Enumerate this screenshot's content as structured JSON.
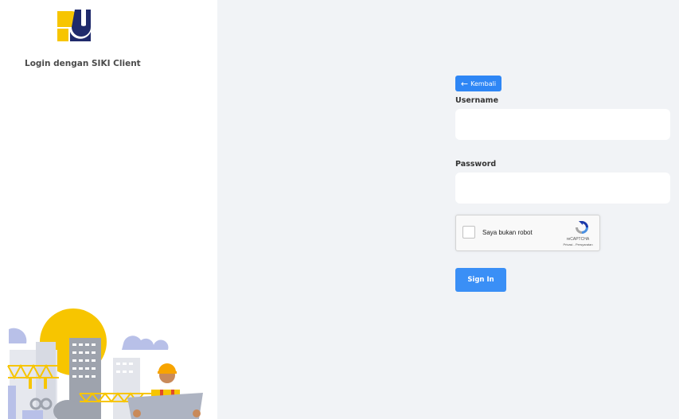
{
  "sidebar": {
    "title": "Login dengan SIKI Client"
  },
  "form": {
    "back_label": "Kembali",
    "username_label": "Username",
    "username_value": "",
    "password_label": "Password",
    "password_value": "",
    "signin_label": "Sign In"
  },
  "recaptcha": {
    "checkbox_label": "Saya bukan robot",
    "brand": "reCAPTCHA",
    "links": "Privasi - Persyaratan"
  },
  "colors": {
    "accent": "#2e86f5",
    "right_bg": "#f1f3f6",
    "logo_blue": "#1f2a6b",
    "logo_yellow": "#f7c500"
  }
}
